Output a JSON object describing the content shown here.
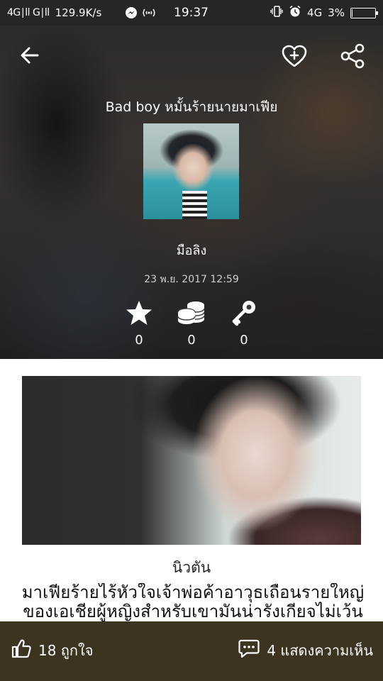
{
  "status_bar": {
    "network": "4G∣ll G∣ll",
    "speed": "129.9K/s",
    "time": "19:37",
    "network_right": "4G",
    "battery": "3%",
    "battery_level": 0.03
  },
  "header": {
    "story_title": "Bad boy หมั้นร้ายนายมาเฟีย",
    "author": "มือลิง",
    "date": "23 พ.ย. 2017 12:59",
    "stats": {
      "stars": "0",
      "coins": "0",
      "keys": "0"
    }
  },
  "content": {
    "genre": "นิวตัน",
    "synopsis": "มาเฟียร้ายไร้หัวใจเจ้าพ่อค้าอาวุธเถื่อนรายใหญ่ของเอเชียผู้หญิงสำหรับเขามันน่ารังเกียจไม่เว้น"
  },
  "bottom_bar": {
    "likes": "18 ถูกใจ",
    "comments": "4 แสดงความเห็น"
  },
  "colors": {
    "bottom_bar": "#3c3320",
    "status_bar": "#262626"
  }
}
